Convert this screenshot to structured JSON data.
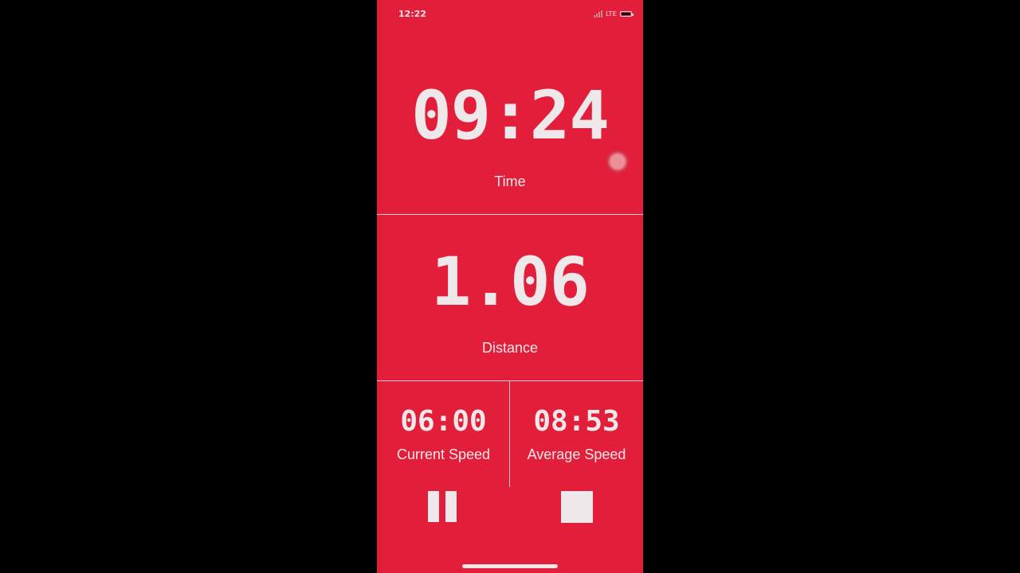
{
  "status_bar": {
    "time": "12:22",
    "network": "LTE",
    "icons": [
      "signal-icon",
      "battery-icon"
    ]
  },
  "timer": {
    "value": "09:24",
    "label": "Time"
  },
  "distance": {
    "value": "1.06",
    "label": "Distance"
  },
  "current_speed": {
    "value": "06:00",
    "label": "Current Speed"
  },
  "average_speed": {
    "value": "08:53",
    "label": "Average Speed"
  },
  "controls": {
    "pause_icon": "pause-icon",
    "stop_icon": "stop-icon"
  },
  "colors": {
    "background": "#e31e3a",
    "foreground": "#efe8ea",
    "outer": "#000000"
  }
}
